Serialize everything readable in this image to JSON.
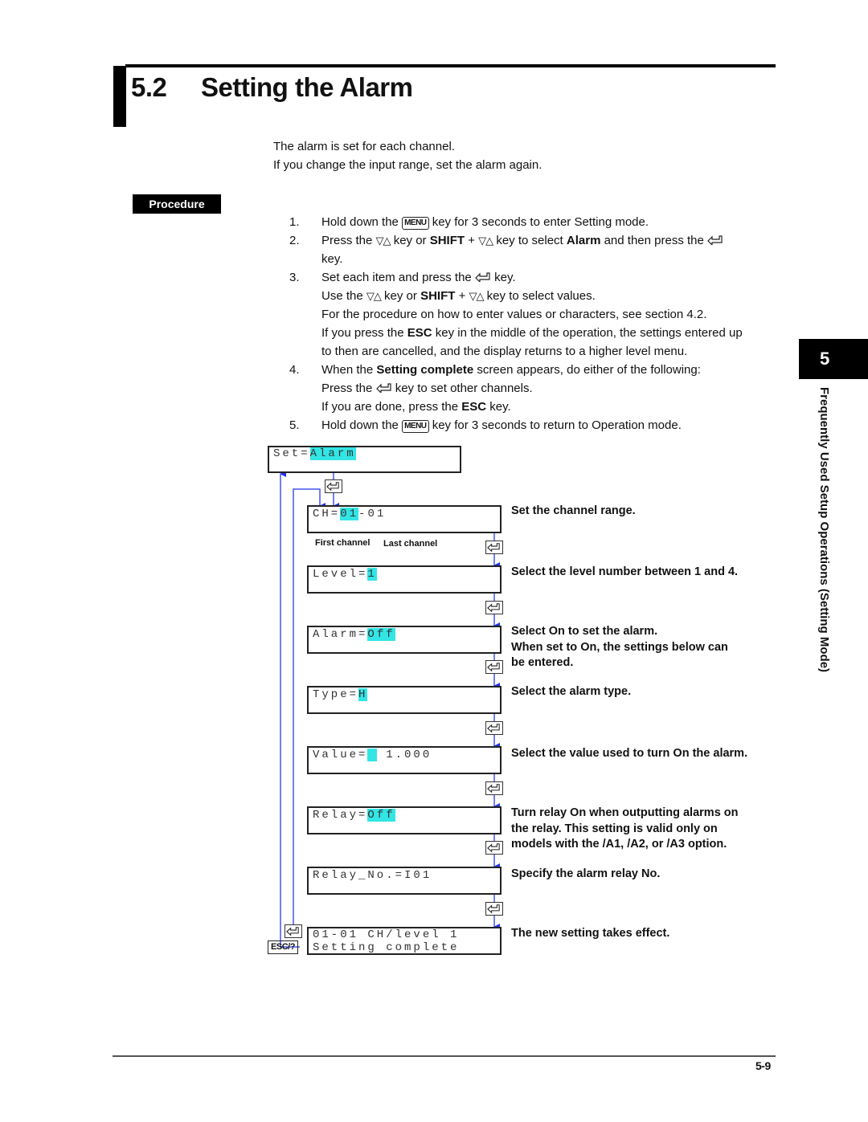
{
  "section": {
    "number": "5.2",
    "title": "Setting the Alarm"
  },
  "intro": [
    "The alarm is set for each channel.",
    "If you change the input range, set the alarm again."
  ],
  "procedure_label": "Procedure",
  "keys": {
    "menu": "MENU",
    "updown_icon": "down-up-triangle-icon",
    "enter_icon": "enter-arrow-icon",
    "esc": "ESC/?"
  },
  "steps": {
    "s1": {
      "num": "1.",
      "a": "Hold down the ",
      "b": " key for 3 seconds to enter Setting mode."
    },
    "s2": {
      "num": "2.",
      "a": "Press the ",
      "b": " key or ",
      "shift": "SHIFT",
      "c": " + ",
      "d": " key to select ",
      "alarm": "Alarm",
      "e": " and then press the ",
      "f": "key."
    },
    "s3": {
      "num": "3.",
      "a": "Set each item and press the ",
      "b": " key.",
      "l2a": "Use the ",
      "l2b": " key or ",
      "l2shift": "SHIFT",
      "l2c": " + ",
      "l2d": " key to select values.",
      "l3": "For the procedure on how to enter values or characters, see section 4.2.",
      "l4a": "If you press the ",
      "l4esc": "ESC",
      "l4b": " key in the middle of the operation, the settings entered up",
      "l5": "to then are cancelled, and the display returns to a higher level menu."
    },
    "s4": {
      "num": "4.",
      "a": "When the ",
      "bold": "Setting complete",
      "b": " screen appears, do either of the following:",
      "l2a": "Press the ",
      "l2b": " key to set other channels.",
      "l3a": "If you are done, press the ",
      "l3esc": "ESC",
      "l3b": " key."
    },
    "s5": {
      "num": "5.",
      "a": "Hold down the ",
      "b": " key for 3 seconds to return to Operation mode."
    }
  },
  "flow": {
    "set": {
      "label": "Set=",
      "value": "Alarm"
    },
    "ch": {
      "label": "CH=",
      "first": "01",
      "sep": "-",
      "last": "01",
      "first_caption": "First channel",
      "last_caption": "Last channel",
      "desc": "Set the channel range."
    },
    "level": {
      "label": "Level=",
      "value": "1",
      "desc": "Select the level number between 1 and 4."
    },
    "alarm": {
      "label": "Alarm=",
      "value": "Off",
      "desc": [
        "Select On to set the alarm.",
        "When set to On, the settings below can",
        "be entered."
      ]
    },
    "type": {
      "label": "Type=",
      "value": "H",
      "desc": "Select the alarm type."
    },
    "value": {
      "label": "Value=",
      "cursor": " ",
      "number": " 1.000",
      "desc": "Select the value used to turn On the alarm."
    },
    "relay": {
      "label": "Relay=",
      "value": "Off",
      "desc": [
        "Turn relay On when outputting alarms on",
        "the relay.  This setting is valid only on",
        "models with the /A1, /A2, or /A3 option."
      ]
    },
    "relay_no": {
      "text": "Relay_No.=I01",
      "desc": "Specify the alarm relay No."
    },
    "complete": {
      "line1": "01-01 CH/level 1",
      "line2": "Setting complete",
      "desc": "The new setting takes effect."
    }
  },
  "chapter": {
    "number": "5",
    "title": "Frequently Used Setup Operations (Setting Mode)"
  },
  "page_number": "5-9",
  "colors": {
    "highlight": "#33e5e5",
    "flow_line": "#3344ee"
  }
}
